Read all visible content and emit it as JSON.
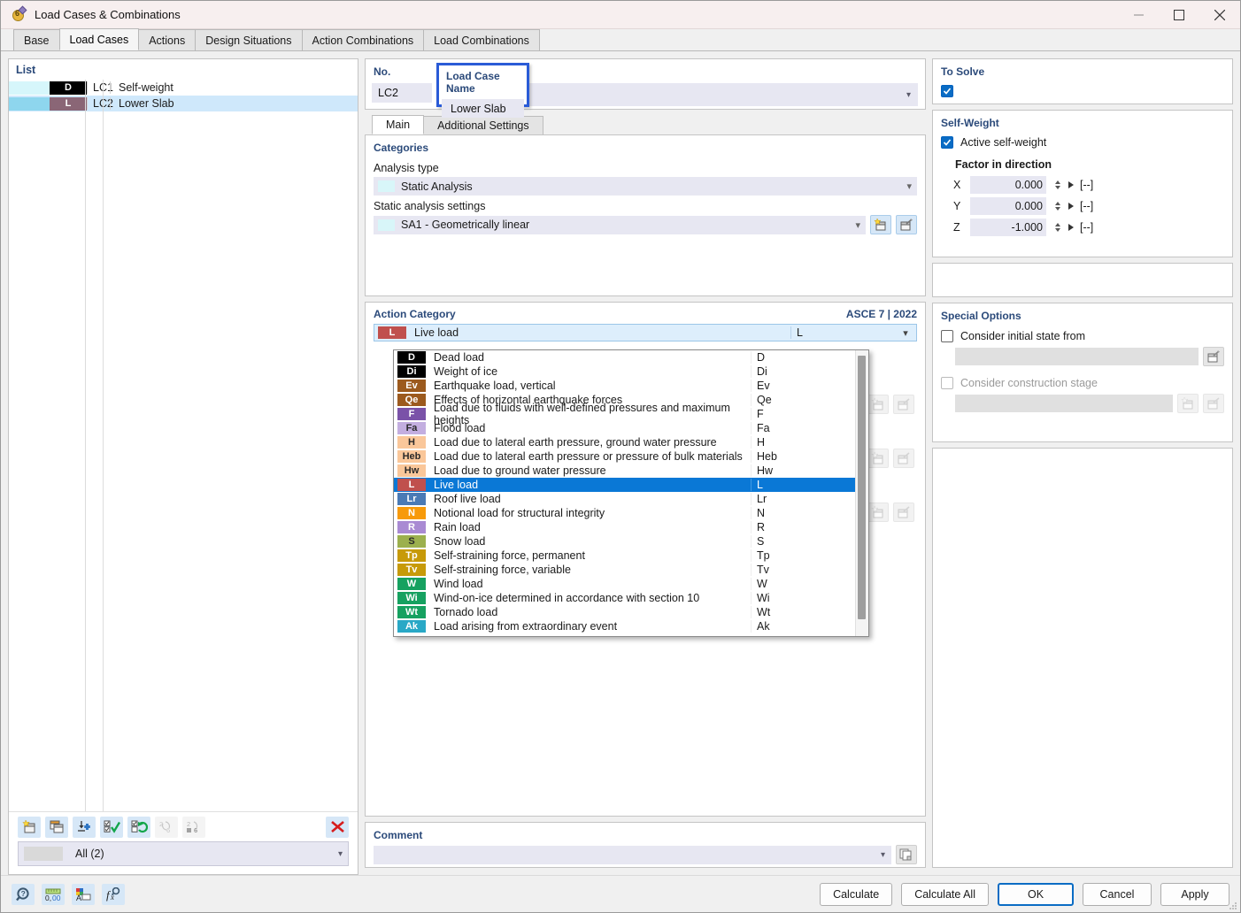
{
  "window": {
    "title": "Load Cases & Combinations",
    "icon": "load-case-icon",
    "minimize": "minimize-icon",
    "maximize": "maximize-icon",
    "close": "close-icon"
  },
  "tabs": [
    {
      "label": "Base",
      "active": false
    },
    {
      "label": "Load Cases",
      "active": true
    },
    {
      "label": "Actions",
      "active": false
    },
    {
      "label": "Design Situations",
      "active": false
    },
    {
      "label": "Action Combinations",
      "active": false
    },
    {
      "label": "Load Combinations",
      "active": false
    }
  ],
  "list": {
    "title": "List",
    "rows": [
      {
        "no": "LC1",
        "name": "Self-weight",
        "tag": "D",
        "tag_color": "#000000",
        "sw1": "#d6f6fb",
        "sw2": "#d6f6fb",
        "selected": false
      },
      {
        "no": "LC2",
        "name": "Lower Slab",
        "tag": "L",
        "tag_color": "#8a6676",
        "sw1": "#8ed6ee",
        "sw2": "#8ed6ee",
        "selected": true
      }
    ],
    "toolbar": [
      {
        "name": "new-load-case-icon",
        "enabled": true
      },
      {
        "name": "copy-load-case-icon",
        "enabled": true
      },
      {
        "name": "import-load-case-icon",
        "enabled": true
      },
      {
        "name": "select-all-icon",
        "enabled": true
      },
      {
        "name": "invert-selection-icon",
        "enabled": true
      },
      {
        "name": "renumber-icon",
        "enabled": false
      },
      {
        "name": "renumber-fixed-icon",
        "enabled": false
      },
      {
        "name": "delete-load-case-icon",
        "enabled": true
      }
    ],
    "filter_value": "All (2)"
  },
  "header": {
    "no_label": "No.",
    "no_value": "LC2",
    "name_label": "Load Case Name",
    "name_value": "Lower Slab"
  },
  "inner_tabs": [
    {
      "label": "Main",
      "active": true
    },
    {
      "label": "Additional Settings",
      "active": false
    }
  ],
  "categories": {
    "title": "Categories",
    "analysis_type_label": "Analysis type",
    "analysis_type_value": "Static Analysis",
    "static_settings_label": "Static analysis settings",
    "static_settings_value": "SA1 - Geometrically linear",
    "new_icon": "new-settings-icon",
    "edit_icon": "edit-settings-icon"
  },
  "action_category": {
    "title": "Action Category",
    "standard": "ASCE 7 | 2022",
    "selected": {
      "tag": "L",
      "name": "Live load",
      "code": "L",
      "color": "#c0504d"
    },
    "options": [
      {
        "tag": "D",
        "name": "Dead load",
        "code": "D",
        "color": "#000000",
        "selected": false
      },
      {
        "tag": "Di",
        "name": "Weight of ice",
        "code": "Di",
        "color": "#000000",
        "selected": false
      },
      {
        "tag": "Ev",
        "name": "Earthquake load, vertical",
        "code": "Ev",
        "color": "#9c5a1e",
        "selected": false
      },
      {
        "tag": "Qe",
        "name": "Effects of horizontal earthquake forces",
        "code": "Qe",
        "color": "#9c5a1e",
        "selected": false
      },
      {
        "tag": "F",
        "name": "Load due to fluids with well-defined pressures and maximum heights",
        "code": "F",
        "color": "#7a52a8",
        "selected": false
      },
      {
        "tag": "Fa",
        "name": "Flood load",
        "code": "Fa",
        "color": "#c3aee0",
        "selected": false
      },
      {
        "tag": "H",
        "name": "Load due to lateral earth pressure, ground water pressure",
        "code": "H",
        "color": "#fac79a",
        "selected": false
      },
      {
        "tag": "Heb",
        "name": "Load due to lateral earth pressure or pressure of bulk materials",
        "code": "Heb",
        "color": "#fac79a",
        "selected": false
      },
      {
        "tag": "Hw",
        "name": "Load due to ground water pressure",
        "code": "Hw",
        "color": "#fac79a",
        "selected": false
      },
      {
        "tag": "L",
        "name": "Live load",
        "code": "L",
        "color": "#c0504d",
        "selected": true
      },
      {
        "tag": "Lr",
        "name": "Roof live load",
        "code": "Lr",
        "color": "#4a7ab5",
        "selected": false
      },
      {
        "tag": "N",
        "name": "Notional load for structural integrity",
        "code": "N",
        "color": "#f79a0a",
        "selected": false
      },
      {
        "tag": "R",
        "name": "Rain load",
        "code": "R",
        "color": "#a98ad3",
        "selected": false
      },
      {
        "tag": "S",
        "name": "Snow load",
        "code": "S",
        "color": "#9cb04e",
        "selected": false
      },
      {
        "tag": "Tp",
        "name": "Self-straining force, permanent",
        "code": "Tp",
        "color": "#c79a09",
        "selected": false
      },
      {
        "tag": "Tv",
        "name": "Self-straining force, variable",
        "code": "Tv",
        "color": "#c79a09",
        "selected": false
      },
      {
        "tag": "W",
        "name": "Wind load",
        "code": "W",
        "color": "#16a160",
        "selected": false
      },
      {
        "tag": "Wi",
        "name": "Wind-on-ice determined in accordance with section 10",
        "code": "Wi",
        "color": "#16a160",
        "selected": false
      },
      {
        "tag": "Wt",
        "name": "Tornado load",
        "code": "Wt",
        "color": "#16a160",
        "selected": false
      },
      {
        "tag": "Ak",
        "name": "Load arising from extraordinary event",
        "code": "Ak",
        "color": "#29a8c6",
        "selected": false
      }
    ]
  },
  "comment": {
    "title": "Comment",
    "value": "",
    "copy_icon": "copy-comment-icon"
  },
  "to_solve": {
    "title": "To Solve",
    "checked": true
  },
  "self_weight": {
    "title": "Self-Weight",
    "active_label": "Active self-weight",
    "active_checked": true,
    "factor_label": "Factor in direction",
    "factors": [
      {
        "axis": "X",
        "value": "0.000",
        "unit": "[--]"
      },
      {
        "axis": "Y",
        "value": "0.000",
        "unit": "[--]"
      },
      {
        "axis": "Z",
        "value": "-1.000",
        "unit": "[--]"
      }
    ]
  },
  "special_options": {
    "title": "Special Options",
    "initial_state_label": "Consider initial state from",
    "initial_state_checked": false,
    "initial_state_value": "",
    "construction_stage_label": "Consider construction stage",
    "construction_stage_checked": false,
    "construction_stage_value": "",
    "edit_icon": "edit-icon",
    "new_icon": "new-icon"
  },
  "bottom": {
    "tools": [
      {
        "name": "help-search-icon"
      },
      {
        "name": "units-icon"
      },
      {
        "name": "text-settings-icon"
      },
      {
        "name": "formula-icon"
      }
    ],
    "buttons": [
      {
        "label": "Calculate",
        "primary": false
      },
      {
        "label": "Calculate All",
        "primary": false
      },
      {
        "label": "OK",
        "primary": true
      },
      {
        "label": "Cancel",
        "primary": false
      },
      {
        "label": "Apply",
        "primary": false
      }
    ]
  },
  "colors": {
    "accent": "#0a6cc4",
    "panel_title": "#2b4a7a",
    "highlight": "#0a78d6",
    "field_bg": "#e7e7f2"
  }
}
